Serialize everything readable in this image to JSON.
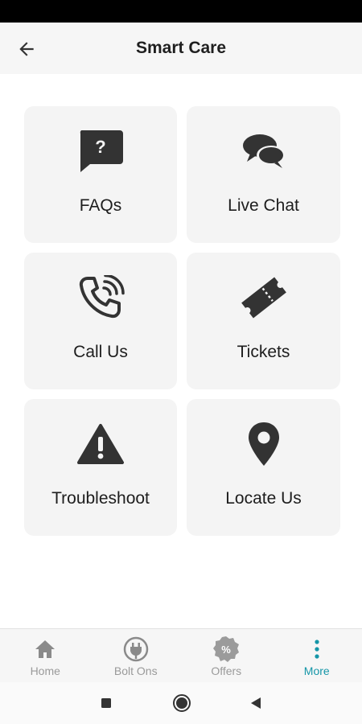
{
  "header": {
    "title": "Smart Care",
    "back_icon": "arrow-left-icon"
  },
  "cards": [
    {
      "label": "FAQs",
      "icon": "question-bubble-icon"
    },
    {
      "label": "Live Chat",
      "icon": "chat-bubbles-icon"
    },
    {
      "label": "Call Us",
      "icon": "phone-ringing-icon"
    },
    {
      "label": "Tickets",
      "icon": "ticket-icon"
    },
    {
      "label": "Troubleshoot",
      "icon": "warning-icon"
    },
    {
      "label": "Locate Us",
      "icon": "location-pin-icon"
    }
  ],
  "bottom_nav": [
    {
      "label": "Home",
      "icon": "home-icon",
      "active": false
    },
    {
      "label": "Bolt Ons",
      "icon": "plug-icon",
      "active": false
    },
    {
      "label": "Offers",
      "icon": "percent-badge-icon",
      "active": false
    },
    {
      "label": "More",
      "icon": "more-vertical-icon",
      "active": true
    }
  ],
  "colors": {
    "accent": "#1596a8",
    "icon_dark": "#333333",
    "nav_inactive": "#9a9a9a",
    "card_bg": "#f4f4f4"
  }
}
